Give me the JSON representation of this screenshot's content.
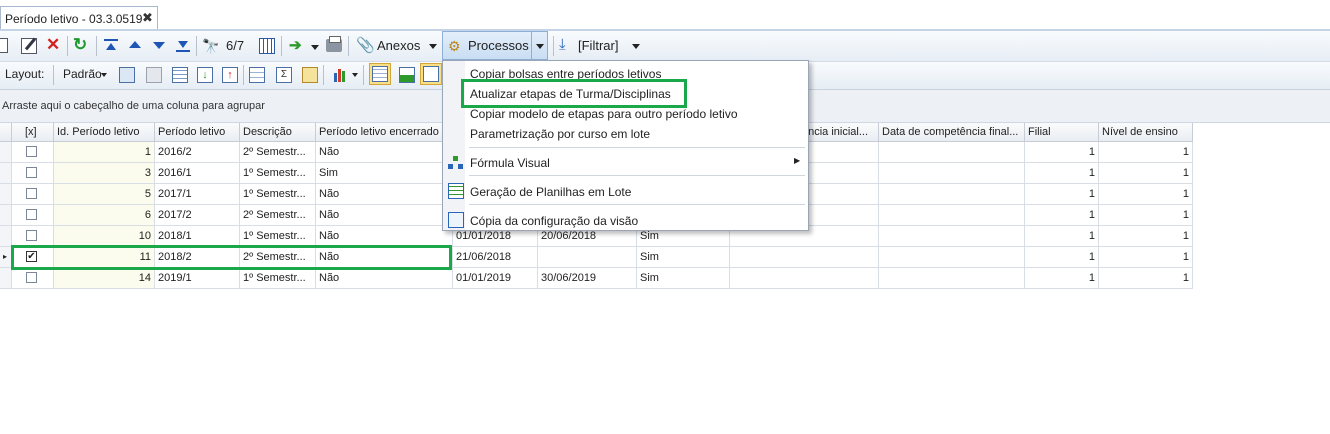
{
  "tab": {
    "title": "Período letivo - 03.3.0519",
    "close": "✖"
  },
  "toolbar": {
    "record_counter": "6/7",
    "anexos": "Anexos",
    "processos": "Processos",
    "filtrar": "[Filtrar]"
  },
  "toolbar2": {
    "layout_label": "Layout:",
    "layout_value": "Padrão"
  },
  "group_panel": {
    "hint": "Arraste aqui o cabeçalho de uma coluna para agrupar"
  },
  "grid": {
    "columns": [
      "[x]",
      "Id. Período letivo",
      "Período letivo",
      "Descrição",
      "Período letivo encerrado",
      "ência inicial...",
      "Data de competência final...",
      "Filial",
      "Nível de ensino"
    ],
    "rows": [
      {
        "checked": false,
        "id": "1",
        "periodo": "2016/2",
        "descricao": "2º Semestr...",
        "encerrado": "Não",
        "inicio": "",
        "fim": "",
        "flag": "",
        "filial": "1",
        "nivel": "1"
      },
      {
        "checked": false,
        "id": "3",
        "periodo": "2016/1",
        "descricao": "1º Semestr...",
        "encerrado": "Sim",
        "inicio": "",
        "fim": "",
        "flag": "",
        "filial": "1",
        "nivel": "1"
      },
      {
        "checked": false,
        "id": "5",
        "periodo": "2017/1",
        "descricao": "1º Semestr...",
        "encerrado": "Não",
        "inicio": "",
        "fim": "",
        "flag": "",
        "filial": "1",
        "nivel": "1"
      },
      {
        "checked": false,
        "id": "6",
        "periodo": "2017/2",
        "descricao": "2º Semestr...",
        "encerrado": "Não",
        "inicio": "",
        "fim": "",
        "flag": "",
        "filial": "1",
        "nivel": "1"
      },
      {
        "checked": false,
        "id": "10",
        "periodo": "2018/1",
        "descricao": "1º Semestr...",
        "encerrado": "Não",
        "inicio": "01/01/2018",
        "fim": "20/06/2018",
        "flag": "Sim",
        "filial": "1",
        "nivel": "1"
      },
      {
        "checked": true,
        "id": "11",
        "periodo": "2018/2",
        "descricao": "2º Semestr...",
        "encerrado": "Não",
        "inicio": "21/06/2018",
        "fim": "",
        "flag": "Sim",
        "filial": "1",
        "nivel": "1"
      },
      {
        "checked": false,
        "id": "14",
        "periodo": "2019/1",
        "descricao": "1º Semestr...",
        "encerrado": "Não",
        "inicio": "01/01/2019",
        "fim": "30/06/2019",
        "flag": "Sim",
        "filial": "1",
        "nivel": "1"
      }
    ]
  },
  "menu": {
    "items": [
      "Copiar bolsas entre períodos letivos",
      "Atualizar etapas de Turma/Disciplinas",
      "Copiar modelo de etapas para outro período letivo",
      "Parametrização por curso em lote",
      "Fórmula Visual",
      "Geração de Planilhas em Lote",
      "Cópia da configuração da visão"
    ],
    "submenu_arrow": "▶"
  },
  "colors": {
    "highlight": "#1aa84a",
    "checkbox_selected_row": "#c9e0f7"
  }
}
